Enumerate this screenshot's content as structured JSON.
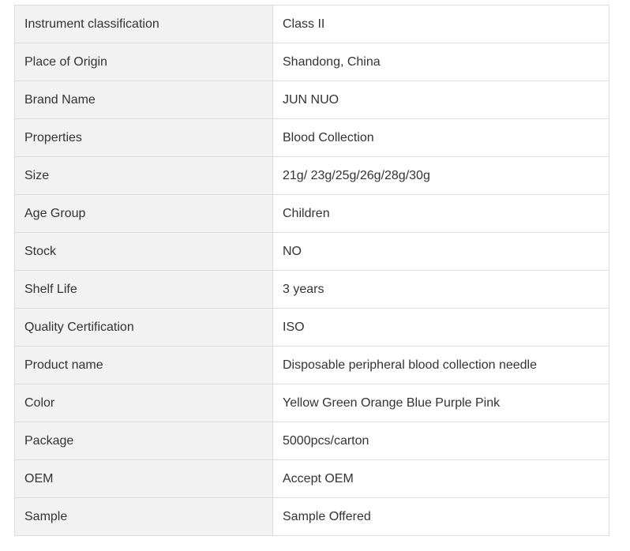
{
  "spec_table": {
    "rows": [
      {
        "label": "Instrument classification",
        "value": "Class II"
      },
      {
        "label": "Place of Origin",
        "value": "Shandong, China"
      },
      {
        "label": "Brand Name",
        "value": "JUN NUO"
      },
      {
        "label": "Properties",
        "value": "Blood Collection"
      },
      {
        "label": "Size",
        "value": "21g/ 23g/25g/26g/28g/30g"
      },
      {
        "label": "Age Group",
        "value": "Children"
      },
      {
        "label": "Stock",
        "value": "NO"
      },
      {
        "label": "Shelf Life",
        "value": "3 years"
      },
      {
        "label": "Quality Certification",
        "value": "ISO"
      },
      {
        "label": "Product name",
        "value": "Disposable peripheral blood collection needle"
      },
      {
        "label": "Color",
        "value": "Yellow Green Orange Blue Purple Pink"
      },
      {
        "label": "Package",
        "value": "5000pcs/carton"
      },
      {
        "label": "OEM",
        "value": "Accept OEM"
      },
      {
        "label": "Sample",
        "value": "Sample Offered"
      }
    ]
  },
  "colors": {
    "label_bg": "#f2f2f2",
    "value_bg": "#ffffff",
    "border": "#dcdcdc",
    "text": "#333333"
  }
}
